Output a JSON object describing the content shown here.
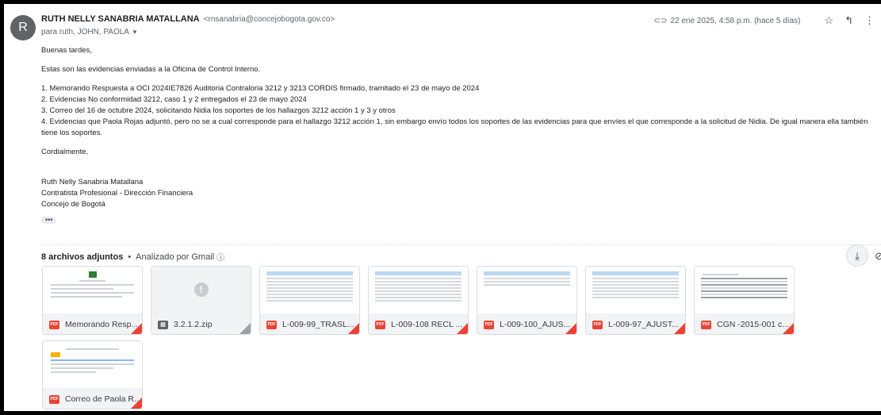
{
  "sender": {
    "initial": "R",
    "name": "RUTH NELLY SANABRIA MATALLANA",
    "email": "<rnsanabria@concejobogota.gov.co>",
    "recipients": "para ruth, JOHN, PAOLA"
  },
  "meta": {
    "label_icon": "label-icon",
    "date": "22 ene 2025, 4:58 p.m. (hace 5 días)",
    "star_icon": "star-icon",
    "reply_icon": "reply-icon",
    "more_icon": "more-vert-icon"
  },
  "body": {
    "greeting": "Buenas tardes,",
    "intro": "Estas son las evidencias enviadas a la Oficina de Control Interno.",
    "items": [
      "1. Memorando Respuesta a OCI 2024IE7826 Auditoria Contraloria 3212 y 3213 CORDIS firmado, tramitado el 23 de mayo de 2024",
      "2. Evidencias No conformidad 3212, caso 1 y 2 entregados el 23 de mayo 2024",
      "3. Correo del 16 de octubre 2024, solicitando Nidia los soportes de los hallazgos 3212 acción 1 y 3 y otros",
      "4. Evidencias que Paola Rojas adjuntó, pero no se a cual corresponde para el hallazgo 3212 acción 1, sin embargo envío todos los soportes de las evidencias para que envíes el que corresponde a la solicitud de Nidia. De igual manera ella también tiene los soportes."
    ],
    "closing": "Cordialmente,",
    "signature": [
      "Ruth Nelly Sanabria Matallana",
      "Contratista Profesional - Dirección Financiera",
      "Concejo de Bogotá"
    ],
    "ellipsis": "•••"
  },
  "attachments": {
    "count_label": "8 archivos adjuntos",
    "separator": "•",
    "scan_label": "Analizado por Gmail",
    "info_icon": "ⓘ",
    "download_icon": "⤓",
    "drive_icon": "⊘",
    "pdf_badge": "PDF",
    "zip_badge": "▤",
    "files": [
      {
        "name": "Memorando Resp...",
        "type": "pdf"
      },
      {
        "name": "3.2.1.2.zip",
        "type": "zip"
      },
      {
        "name": "L-009-99_TRASL...",
        "type": "pdf"
      },
      {
        "name": "L-009-108 RECL ...",
        "type": "pdf"
      },
      {
        "name": "L-009-100_AJUS...",
        "type": "pdf"
      },
      {
        "name": "L-009-97_AJUST...",
        "type": "pdf"
      },
      {
        "name": "CGN -2015-001 c...",
        "type": "pdf"
      },
      {
        "name": "Correo de Paola R...",
        "type": "pdf"
      }
    ]
  }
}
